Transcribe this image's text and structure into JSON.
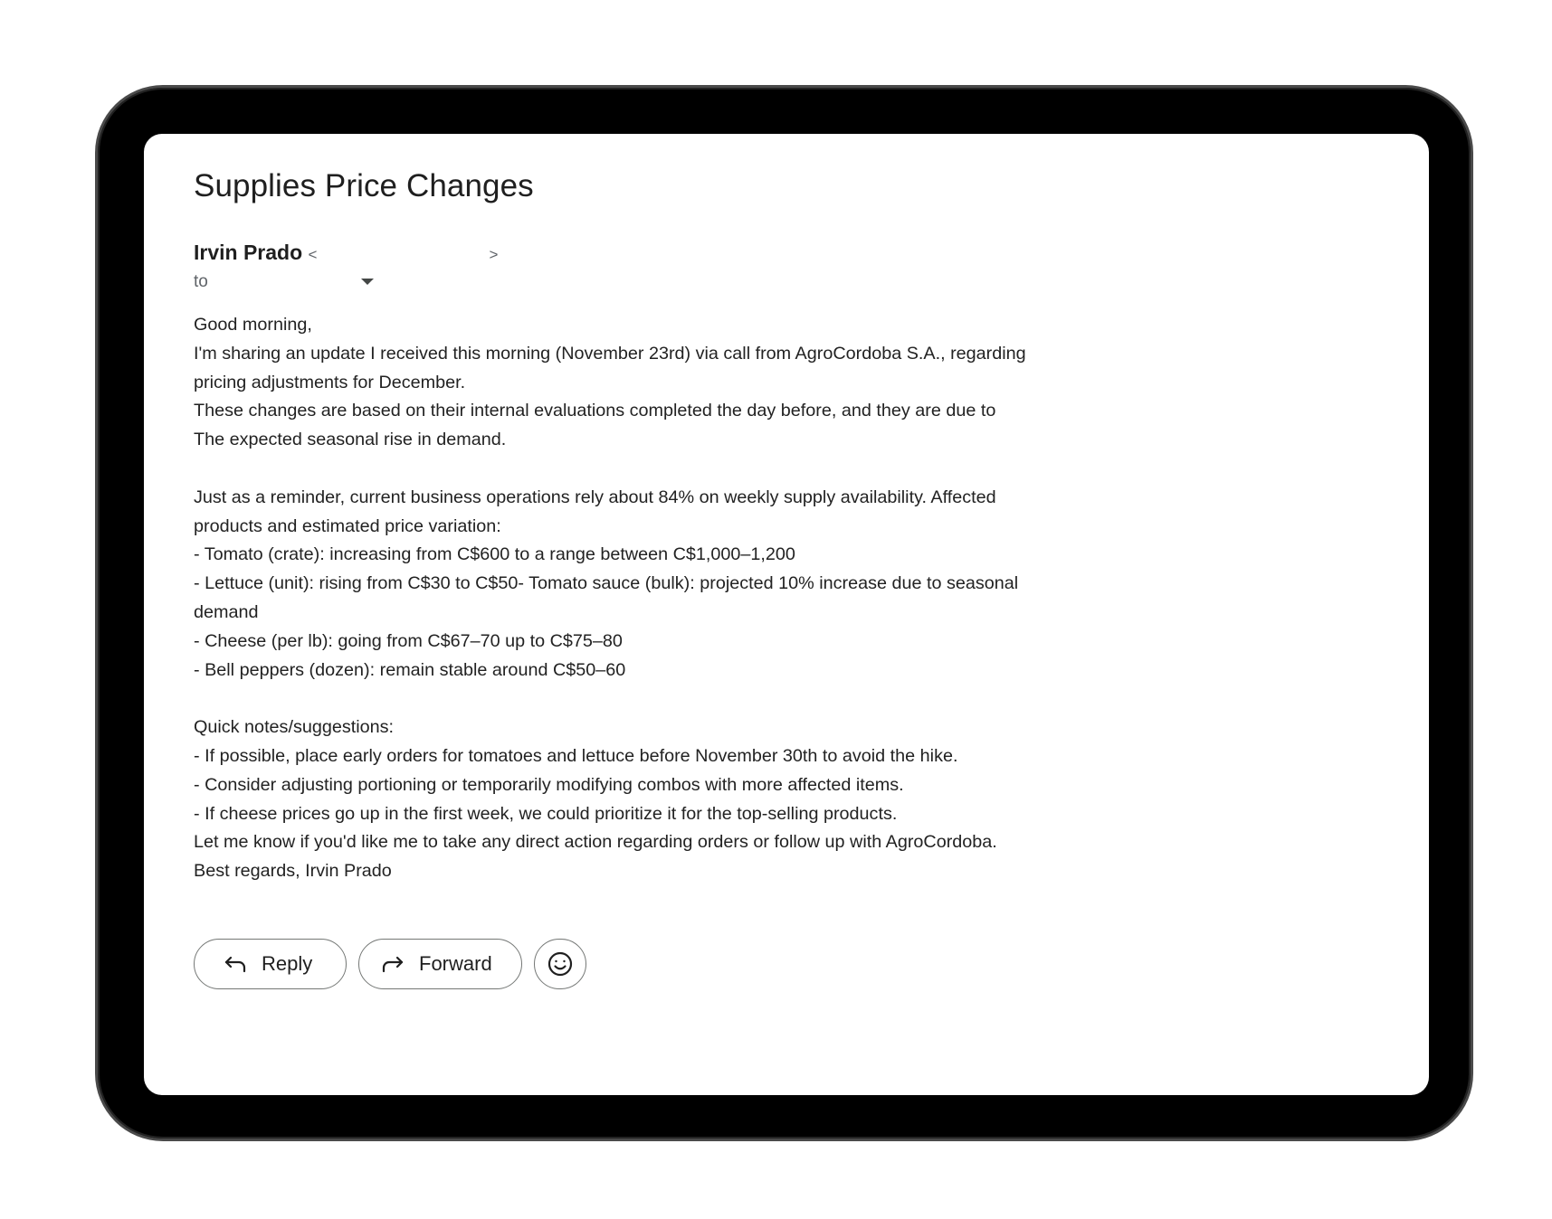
{
  "email": {
    "subject": "Supplies Price Changes",
    "sender_name": "Irvin Prado",
    "sender_email_open": "<",
    "sender_email_close": ">",
    "to_label": "to",
    "body_lines": [
      "Good morning,",
      "I'm sharing an update I received this morning (November 23rd) via call from AgroCordoba S.A., regarding",
      "pricing adjustments for December.",
      "These changes are based on their internal evaluations completed the day before, and they are due to",
      "The expected seasonal rise in demand.",
      "",
      "Just as a reminder, current business operations rely about 84% on weekly supply availability. Affected",
      "products and estimated price variation:",
      "- Tomato (crate): increasing from C$600 to a range between C$1,000–1,200",
      "- Lettuce (unit): rising from C$30 to C$50- Tomato sauce (bulk): projected 10% increase due to seasonal",
      "demand",
      "- Cheese (per lb): going from C$67–70 up to C$75–80",
      "- Bell peppers (dozen): remain stable around C$50–60",
      "",
      "Quick notes/suggestions:",
      "- If possible, place early orders for tomatoes and lettuce before November 30th to avoid the hike.",
      "- Consider adjusting portioning or temporarily modifying combos with more affected items.",
      "- If cheese prices go up in the first week, we could prioritize it for the top-selling products.",
      "Let me know if you'd like me to take any direct action regarding orders or follow up with AgroCordoba.",
      "Best regards, Irvin Prado"
    ]
  },
  "actions": {
    "reply_label": "Reply",
    "reply_icon": "reply-arrow-icon",
    "forward_label": "Forward",
    "forward_icon": "forward-arrow-icon",
    "emoji_icon": "smiley-icon"
  }
}
